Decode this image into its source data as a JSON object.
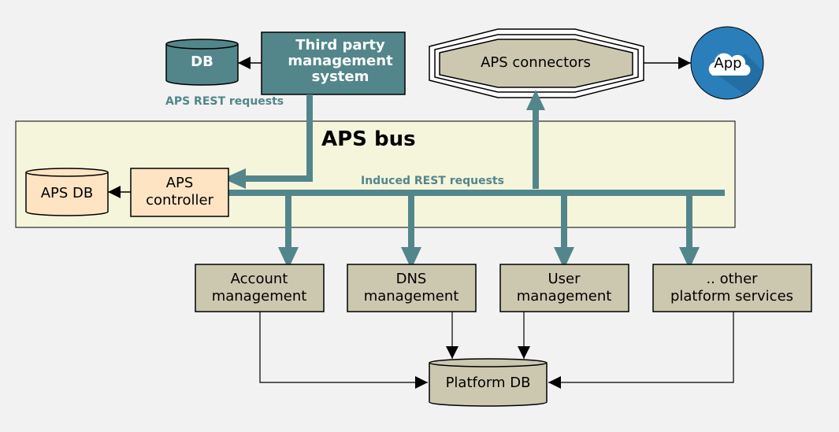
{
  "colors": {
    "teal": "#52868a",
    "tan": "#ccc8b0",
    "bus": "#f5f5dc",
    "peach": "#ffe4c4",
    "app": "#2a7fbb",
    "background": "#f2f2f2"
  },
  "nodes": {
    "db": "DB",
    "third_party": [
      "Third party",
      "management",
      "system"
    ],
    "connectors": "APS connectors",
    "app": "App",
    "bus": "APS bus",
    "aps_db": "APS DB",
    "controller": [
      "APS",
      "controller"
    ],
    "account": [
      "Account",
      "management"
    ],
    "dns": [
      "DNS",
      "management"
    ],
    "user": [
      "User",
      "management"
    ],
    "other": [
      ".. other",
      "platform services"
    ],
    "platform_db": "Platform DB"
  },
  "labels": {
    "rest": "APS REST requests",
    "induced": "Induced REST requests"
  },
  "icons": {
    "app": "cloud-icon"
  }
}
